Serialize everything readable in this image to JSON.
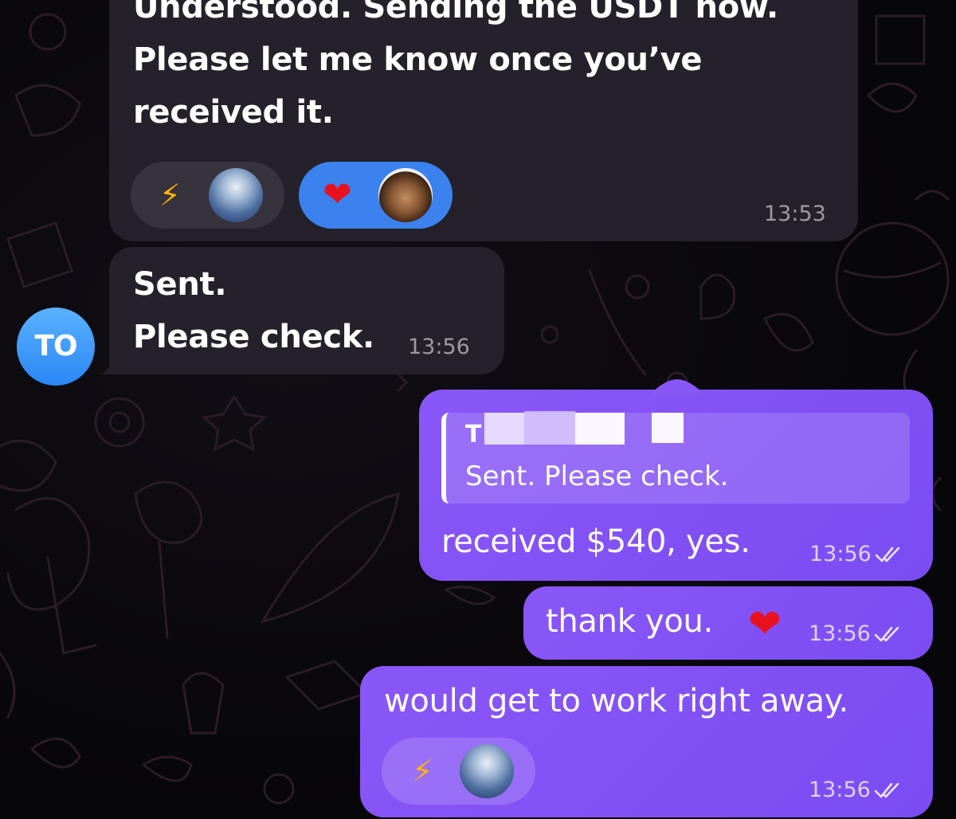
{
  "sender": {
    "initials": "TO",
    "color": "#2a87f5"
  },
  "messages": [
    {
      "id": "msg-1",
      "direction": "incoming",
      "lines": [
        "Understood. Sending the USDT now.",
        "Please let me know once you’ve",
        "received it."
      ],
      "time": "13:53",
      "reactions": [
        {
          "emoji": "⚡",
          "icon": "lightning-bolt-icon",
          "style": "default"
        },
        {
          "emoji": "❤",
          "icon": "heart-icon",
          "style": "chosen"
        }
      ]
    },
    {
      "id": "msg-2",
      "direction": "incoming",
      "lines": [
        "Sent.",
        "Please check."
      ],
      "time": "13:56"
    },
    {
      "id": "msg-3",
      "direction": "outgoing",
      "reply": {
        "name": "T",
        "text": "Sent. Please check."
      },
      "text": "received $540, yes.",
      "time": "13:56",
      "status": "read"
    },
    {
      "id": "msg-4",
      "direction": "outgoing",
      "text": "thank you.",
      "emoji": "❤",
      "time": "13:56",
      "status": "read"
    },
    {
      "id": "msg-5",
      "direction": "outgoing",
      "text": "would get to work right away.",
      "time": "13:56",
      "status": "read",
      "reactions": [
        {
          "emoji": "⚡",
          "icon": "lightning-bolt-icon",
          "style": "default"
        }
      ]
    }
  ],
  "colors": {
    "incoming_bubble": "#24212a",
    "outgoing_bubble": "#8a57f7",
    "chosen_reaction": "#3b82ef"
  }
}
